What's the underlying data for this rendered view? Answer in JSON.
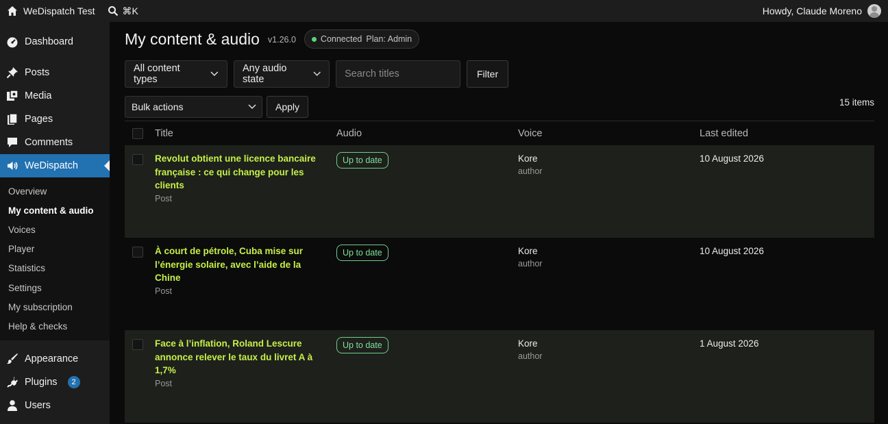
{
  "adminbar": {
    "site_name": "WeDispatch Test",
    "search_shortcut": "⌘K",
    "greeting": "Howdy, Claude Moreno"
  },
  "sidebar": {
    "items": [
      {
        "label": "Dashboard",
        "icon": "dashboard-icon"
      },
      {
        "label": "Posts",
        "icon": "pin-icon"
      },
      {
        "label": "Media",
        "icon": "media-icon"
      },
      {
        "label": "Pages",
        "icon": "pages-icon"
      },
      {
        "label": "Comments",
        "icon": "comment-icon"
      },
      {
        "label": "WeDispatch",
        "icon": "speaker-icon"
      }
    ],
    "submenu": [
      "Overview",
      "My content & audio",
      "Voices",
      "Player",
      "Statistics",
      "Settings",
      "My subscription",
      "Help & checks"
    ],
    "bottom_items": [
      {
        "label": "Appearance",
        "icon": "brush-icon"
      },
      {
        "label": "Plugins",
        "icon": "plug-icon",
        "badge": "2"
      },
      {
        "label": "Users",
        "icon": "user-icon"
      }
    ]
  },
  "header": {
    "title": "My content & audio",
    "version": "v1.26.0",
    "status": "Connected",
    "plan": "Plan: Admin"
  },
  "filters": {
    "content_type": "All content types",
    "audio_state": "Any audio state",
    "search_placeholder": "Search titles",
    "filter_label": "Filter"
  },
  "bulk": {
    "selected": "Bulk actions",
    "apply_label": "Apply",
    "count": "15 items"
  },
  "table": {
    "columns": [
      "Title",
      "Audio",
      "Voice",
      "Last edited"
    ],
    "rows": [
      {
        "title": "Revolut obtient une licence bancaire française : ce qui change pour les clients",
        "type": "Post",
        "audio": "Up to date",
        "voice": "Kore",
        "role": "author",
        "date": "10 August 2026"
      },
      {
        "title": "À court de pétrole, Cuba mise sur l’énergie solaire, avec l’aide de la Chine",
        "type": "Post",
        "audio": "Up to date",
        "voice": "Kore",
        "role": "author",
        "date": "10 August 2026"
      },
      {
        "title": "Face à l’inflation, Roland Lescure annonce relever le taux du livret A à 1,7%",
        "type": "Post",
        "audio": "Up to date",
        "voice": "Kore",
        "role": "author",
        "date": "1 August 2026"
      }
    ]
  },
  "colors": {
    "accent": "#2271b1",
    "title_link": "#c5f049",
    "status_green": "#7fe09a"
  }
}
